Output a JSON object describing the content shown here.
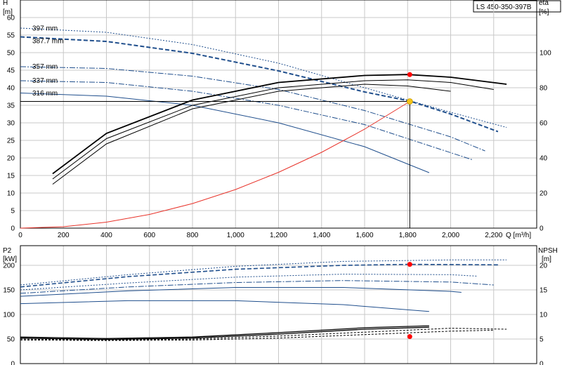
{
  "title": "LS 450-350-397B",
  "colors": {
    "curve": "#1f4e8c",
    "efficiency": "#000000",
    "system": "#e8332a",
    "operating_point": "#ff0000",
    "duty_marker": "#f5c518",
    "grid": "#c8c8c8"
  },
  "chart_data": [
    {
      "type": "line",
      "name": "head",
      "ylabel": "H",
      "yunit": "[m]",
      "y2label": "eta",
      "y2unit": "[%]",
      "xlabel": "Q [m³/h]",
      "xlim": [
        0,
        2400
      ],
      "ylim": [
        0,
        65
      ],
      "y2lim": [
        0,
        130
      ],
      "grid": true,
      "xticks": [
        0,
        200,
        400,
        600,
        800,
        1000,
        1200,
        1400,
        1600,
        1800,
        2000,
        2200
      ],
      "xtick_labels": [
        "0",
        "200",
        "400",
        "600",
        "800",
        "1,000",
        "1,200",
        "1,400",
        "1,600",
        "1,800",
        "2,000",
        "2,200"
      ],
      "yticks": [
        0,
        5,
        10,
        15,
        20,
        25,
        30,
        35,
        40,
        45,
        50,
        55,
        60
      ],
      "y2ticks": [
        0,
        20,
        40,
        60,
        80,
        100
      ],
      "impeller_labels": [
        {
          "text": "397 mm",
          "q": 500,
          "h": 57
        },
        {
          "text": "387.7 mm",
          "q": 500,
          "h": 53.4
        },
        {
          "text": "357 mm",
          "q": 500,
          "h": 46.1
        },
        {
          "text": "337 mm",
          "q": 500,
          "h": 42.1
        },
        {
          "text": "316 mm",
          "q": 500,
          "h": 38.5
        }
      ],
      "head_curves": [
        {
          "diameter": "397 mm",
          "style": "dotted",
          "q": [
            0,
            400,
            800,
            1200,
            1600,
            2000,
            2260
          ],
          "h": [
            57,
            55.8,
            52.3,
            47,
            40,
            33,
            28.7
          ]
        },
        {
          "diameter": "387.7 mm",
          "style": "dashed",
          "q": [
            0,
            400,
            800,
            1200,
            1600,
            1810,
            2000,
            2220
          ],
          "h": [
            54.5,
            53.2,
            49.8,
            44.8,
            38.8,
            36.2,
            32.5,
            27.5
          ]
        },
        {
          "diameter": "357 mm",
          "style": "mixed",
          "q": [
            0,
            400,
            800,
            1200,
            1600,
            2000,
            2160
          ],
          "h": [
            46,
            45.5,
            43.3,
            39.5,
            33.5,
            26,
            22
          ]
        },
        {
          "diameter": "337 mm",
          "style": "mixed",
          "q": [
            0,
            400,
            800,
            1200,
            1600,
            2000,
            2100
          ],
          "h": [
            42,
            41.5,
            39,
            35,
            29.5,
            21.5,
            19.5
          ]
        },
        {
          "diameter": "316 mm",
          "style": "solid",
          "q": [
            0,
            400,
            800,
            1200,
            1600,
            1900
          ],
          "h": [
            38.5,
            37.6,
            35,
            30,
            23.2,
            15.8
          ]
        }
      ],
      "efficiency_curves": [
        {
          "q": [
            150,
            400,
            800,
            1200,
            1600,
            1800,
            2000,
            2260
          ],
          "eta": [
            31,
            54,
            73,
            83,
            87,
            87.5,
            86,
            82
          ]
        },
        {
          "q": [
            150,
            400,
            800,
            1200,
            1600,
            1800,
            2000,
            2200
          ],
          "eta": [
            28,
            51,
            70,
            80,
            84,
            84.5,
            83,
            79
          ]
        },
        {
          "q": [
            150,
            400,
            800,
            1200,
            1600,
            1800,
            2000
          ],
          "eta": [
            25,
            48,
            68,
            78,
            82,
            81,
            78
          ]
        }
      ],
      "system_curve": {
        "q": [
          0,
          200,
          400,
          600,
          800,
          1000,
          1200,
          1400,
          1600,
          1810
        ],
        "h": [
          0,
          0.4,
          1.7,
          3.9,
          7,
          11,
          15.9,
          21.6,
          28.2,
          36.1
        ]
      },
      "duty_point": {
        "q": 1810,
        "h": 36.1,
        "eta": 87.5
      }
    },
    {
      "type": "line",
      "name": "power",
      "ylabel": "P2",
      "yunit": "[kW]",
      "y2label": "NPSH",
      "y2unit": "[m]",
      "xlim": [
        0,
        2400
      ],
      "ylim": [
        0,
        240
      ],
      "y2lim": [
        0,
        24
      ],
      "grid": true,
      "yticks": [
        0,
        50,
        100,
        150,
        200
      ],
      "y2ticks": [
        0,
        5,
        10,
        15,
        20
      ],
      "power_curves": [
        {
          "style": "dotted",
          "q": [
            0,
            500,
            1000,
            1500,
            2000,
            2260
          ],
          "p": [
            160,
            181,
            198,
            208,
            211,
            211
          ]
        },
        {
          "style": "dashed",
          "q": [
            0,
            500,
            1000,
            1500,
            1810,
            2220
          ],
          "p": [
            156,
            177,
            192,
            200,
            202,
            201
          ]
        },
        {
          "style": "dotted",
          "q": [
            0,
            500,
            1000,
            1500,
            2000,
            2120
          ],
          "p": [
            150,
            164,
            176,
            182,
            181,
            178
          ]
        },
        {
          "style": "mixed",
          "q": [
            0,
            500,
            1000,
            1500,
            2000,
            2200
          ],
          "p": [
            143,
            156,
            165,
            169,
            166,
            160
          ]
        },
        {
          "style": "solid",
          "q": [
            0,
            500,
            1000,
            1500,
            2000,
            2050
          ],
          "p": [
            137,
            148,
            155,
            155,
            147,
            145
          ]
        },
        {
          "style": "solid",
          "q": [
            0,
            500,
            1000,
            1500,
            1900
          ],
          "p": [
            122,
            128,
            128,
            120,
            106
          ]
        }
      ],
      "npsh_curves": [
        {
          "q": [
            0,
            400,
            800,
            1200,
            1600,
            1900
          ],
          "npsh": [
            5.2,
            4.9,
            5.2,
            6,
            7,
            7.4
          ]
        },
        {
          "q": [
            0,
            400,
            800,
            1200,
            1600,
            1900
          ],
          "npsh": [
            5.4,
            5.1,
            5.4,
            6.3,
            7.3,
            7.7
          ]
        },
        {
          "q": [
            0,
            400,
            800,
            1200,
            1600,
            2000,
            2260
          ],
          "npsh": [
            5,
            4.8,
            5,
            5.6,
            6.4,
            7.2,
            7
          ]
        },
        {
          "q": [
            0,
            400,
            800,
            1200,
            1600,
            2000,
            2200
          ],
          "npsh": [
            4.8,
            4.7,
            4.8,
            5.2,
            5.9,
            6.6,
            6.8
          ]
        }
      ],
      "duty_point": {
        "q": 1810,
        "p": 202,
        "npsh": 5.5
      }
    }
  ]
}
